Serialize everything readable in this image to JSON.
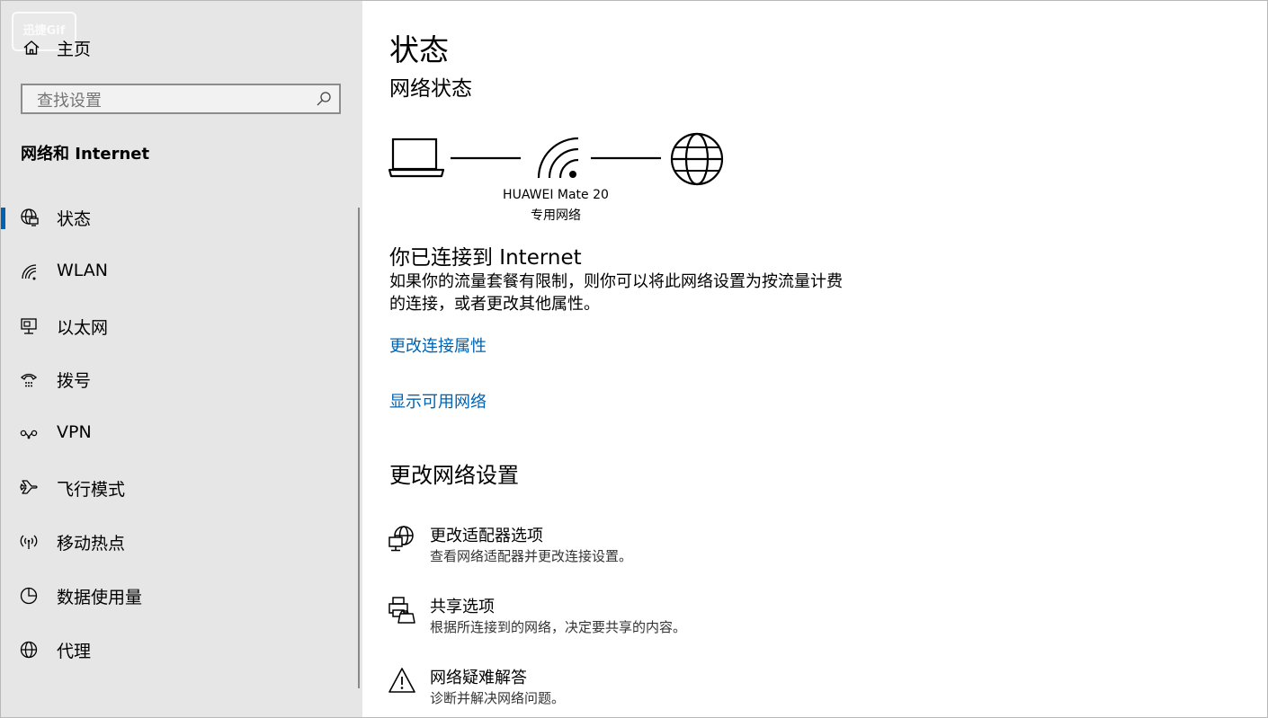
{
  "watermark": "迅捷Gif",
  "sidebar": {
    "home_label": "主页",
    "search_placeholder": "查找设置",
    "section_title": "网络和 Internet",
    "items": [
      {
        "label": "状态",
        "icon": "globe-status-icon"
      },
      {
        "label": "WLAN",
        "icon": "wifi-icon"
      },
      {
        "label": "以太网",
        "icon": "ethernet-icon"
      },
      {
        "label": "拨号",
        "icon": "dialup-icon"
      },
      {
        "label": "VPN",
        "icon": "vpn-icon"
      },
      {
        "label": "飞行模式",
        "icon": "airplane-icon"
      },
      {
        "label": "移动热点",
        "icon": "hotspot-icon"
      },
      {
        "label": "数据使用量",
        "icon": "data-usage-icon"
      },
      {
        "label": "代理",
        "icon": "proxy-globe-icon"
      }
    ]
  },
  "main": {
    "title": "状态",
    "subtitle": "网络状态",
    "network_name": "HUAWEI Mate 20",
    "network_type": "专用网络",
    "connected_title": "你已连接到 Internet",
    "connected_desc": "如果你的流量套餐有限制，则你可以将此网络设置为按流量计费的连接，或者更改其他属性。",
    "link_change_props": "更改连接属性",
    "link_show_networks": "显示可用网络",
    "change_settings_title": "更改网络设置",
    "options": [
      {
        "title": "更改适配器选项",
        "subtitle": "查看网络适配器并更改连接设置。",
        "icon": "adapter-icon"
      },
      {
        "title": "共享选项",
        "subtitle": "根据所连接到的网络，决定要共享的内容。",
        "icon": "sharing-icon"
      },
      {
        "title": "网络疑难解答",
        "subtitle": "诊断并解决网络问题。",
        "icon": "warning-icon"
      }
    ]
  },
  "colors": {
    "accent": "#0063b1",
    "sidebar_bg": "#e6e6e6"
  }
}
